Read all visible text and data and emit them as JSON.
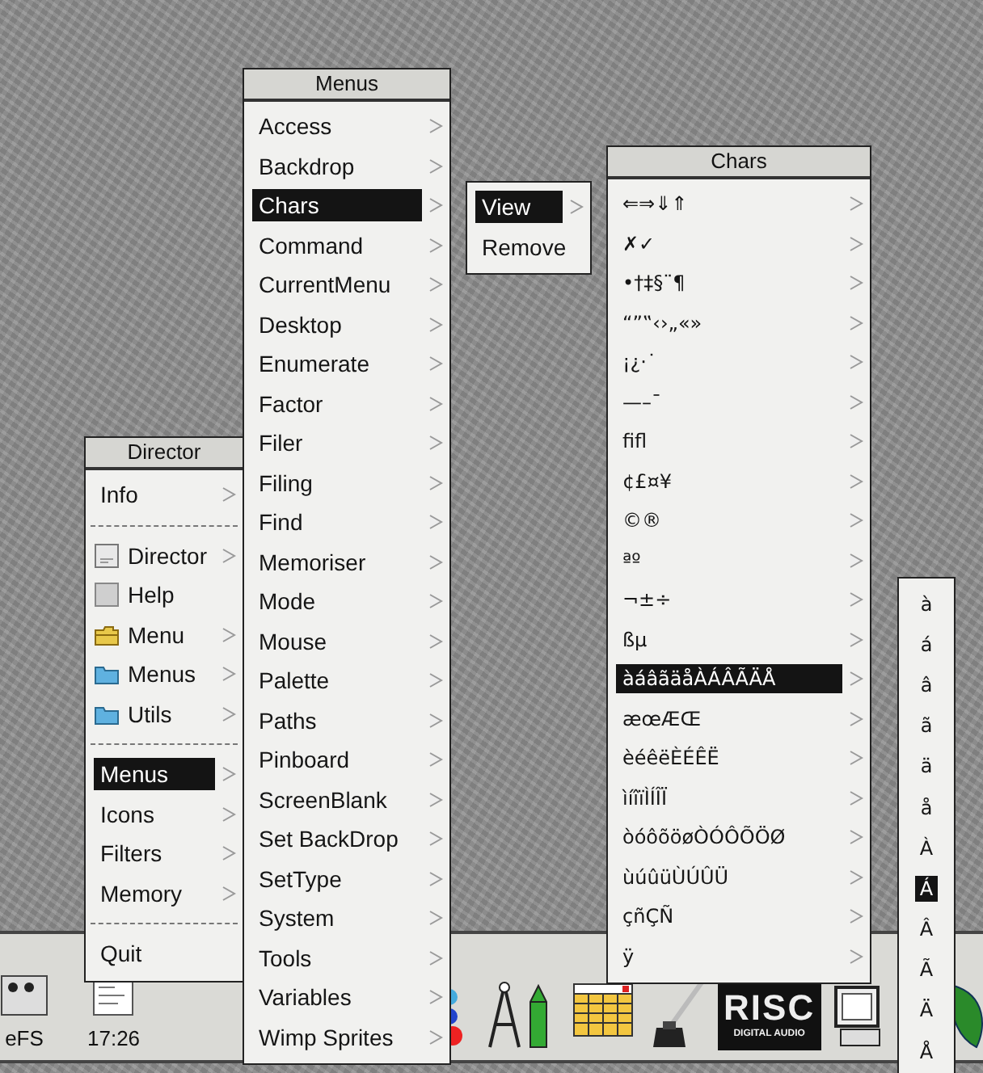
{
  "menus": [
    {
      "title": "Director",
      "items": [
        {
          "label": "Info",
          "submenu": true,
          "selected": false,
          "separator_after": true
        },
        {
          "label": "Director",
          "submenu": true,
          "selected": false,
          "kind": "app"
        },
        {
          "label": "Help",
          "submenu": false,
          "selected": false,
          "kind": "document"
        },
        {
          "label": "Menu",
          "submenu": true,
          "selected": false,
          "kind": "open-folder"
        },
        {
          "label": "Menus",
          "submenu": true,
          "selected": false,
          "kind": "folder"
        },
        {
          "label": "Utils",
          "submenu": true,
          "selected": false,
          "kind": "folder",
          "separator_after": true
        },
        {
          "label": "Menus",
          "submenu": true,
          "selected": true
        },
        {
          "label": "Icons",
          "submenu": true,
          "selected": false
        },
        {
          "label": "Filters",
          "submenu": true,
          "selected": false
        },
        {
          "label": "Memory",
          "submenu": true,
          "selected": false,
          "separator_after": true
        },
        {
          "label": "Quit",
          "submenu": false,
          "selected": false
        }
      ]
    },
    {
      "title": "Menus",
      "items": [
        {
          "label": "Access",
          "submenu": true,
          "selected": false
        },
        {
          "label": "Backdrop",
          "submenu": true,
          "selected": false
        },
        {
          "label": "Chars",
          "submenu": true,
          "selected": true
        },
        {
          "label": "Command",
          "submenu": true,
          "selected": false
        },
        {
          "label": "CurrentMenu",
          "submenu": true,
          "selected": false
        },
        {
          "label": "Desktop",
          "submenu": true,
          "selected": false
        },
        {
          "label": "Enumerate",
          "submenu": true,
          "selected": false
        },
        {
          "label": "Factor",
          "submenu": true,
          "selected": false
        },
        {
          "label": "Filer",
          "submenu": true,
          "selected": false
        },
        {
          "label": "Filing",
          "submenu": true,
          "selected": false
        },
        {
          "label": "Find",
          "submenu": true,
          "selected": false
        },
        {
          "label": "Memoriser",
          "submenu": true,
          "selected": false
        },
        {
          "label": "Mode",
          "submenu": true,
          "selected": false
        },
        {
          "label": "Mouse",
          "submenu": true,
          "selected": false
        },
        {
          "label": "Palette",
          "submenu": true,
          "selected": false
        },
        {
          "label": "Paths",
          "submenu": true,
          "selected": false
        },
        {
          "label": "Pinboard",
          "submenu": true,
          "selected": false
        },
        {
          "label": "ScreenBlank",
          "submenu": true,
          "selected": false
        },
        {
          "label": "Set BackDrop",
          "submenu": true,
          "selected": false
        },
        {
          "label": "SetType",
          "submenu": true,
          "selected": false
        },
        {
          "label": "System",
          "submenu": true,
          "selected": false
        },
        {
          "label": "Tools",
          "submenu": true,
          "selected": false
        },
        {
          "label": "Variables",
          "submenu": true,
          "selected": false
        },
        {
          "label": "Wimp Sprites",
          "submenu": true,
          "selected": false
        }
      ]
    },
    {
      "items": [
        {
          "label": "View",
          "submenu": true,
          "selected": true
        },
        {
          "label": "Remove",
          "submenu": false,
          "selected": false
        }
      ]
    },
    {
      "title": "Chars",
      "items": [
        {
          "label": "⇐⇒⇓⇑",
          "submenu": true,
          "selected": false
        },
        {
          "label": "✗✓",
          "submenu": true,
          "selected": false
        },
        {
          "label": "•†‡§¨¶",
          "submenu": true,
          "selected": false
        },
        {
          "label": "“”‟‹›„«»",
          "submenu": true,
          "selected": false
        },
        {
          "label": "¡¿·˙",
          "submenu": true,
          "selected": false
        },
        {
          "label": "—–¯",
          "submenu": true,
          "selected": false
        },
        {
          "label": "ﬁﬂ",
          "submenu": true,
          "selected": false
        },
        {
          "label": "¢£¤¥",
          "submenu": true,
          "selected": false
        },
        {
          "label": "©®",
          "submenu": true,
          "selected": false
        },
        {
          "label": "ªº",
          "submenu": true,
          "selected": false
        },
        {
          "label": "¬±÷",
          "submenu": true,
          "selected": false
        },
        {
          "label": "ßµ",
          "submenu": true,
          "selected": false
        },
        {
          "label": "àáâãäåÀÁÂÃÄÅ",
          "submenu": true,
          "selected": true
        },
        {
          "label": "æœÆŒ",
          "submenu": true,
          "selected": false
        },
        {
          "label": "èéêëÈÉÊË",
          "submenu": true,
          "selected": false
        },
        {
          "label": "ìíîïÌÍÎÏ",
          "submenu": true,
          "selected": false
        },
        {
          "label": "òóôõöøÒÓÔÕÖØ",
          "submenu": true,
          "selected": false
        },
        {
          "label": "ùúûüÙÚÛÜ",
          "submenu": true,
          "selected": false
        },
        {
          "label": "çñÇÑ",
          "submenu": true,
          "selected": false
        },
        {
          "label": "ÿ",
          "submenu": true,
          "selected": false
        }
      ]
    },
    {
      "items": [
        {
          "label": "à",
          "submenu": false,
          "selected": false
        },
        {
          "label": "á",
          "submenu": false,
          "selected": false
        },
        {
          "label": "â",
          "submenu": false,
          "selected": false
        },
        {
          "label": "ã",
          "submenu": false,
          "selected": false
        },
        {
          "label": "ä",
          "submenu": false,
          "selected": false
        },
        {
          "label": "å",
          "submenu": false,
          "selected": false
        },
        {
          "label": "À",
          "submenu": false,
          "selected": false
        },
        {
          "label": "Á",
          "submenu": false,
          "selected": true
        },
        {
          "label": "Â",
          "submenu": false,
          "selected": false
        },
        {
          "label": "Ã",
          "submenu": false,
          "selected": false
        },
        {
          "label": "Ä",
          "submenu": false,
          "selected": false
        },
        {
          "label": "Å",
          "submenu": false,
          "selected": false
        }
      ]
    }
  ],
  "icon_bar": {
    "items": [
      {
        "kind": "drive",
        "label": "eFS"
      },
      {
        "kind": "clock",
        "label": "17:26"
      },
      {
        "kind": "palette"
      },
      {
        "kind": "draw"
      },
      {
        "kind": "spreadsheet"
      },
      {
        "kind": "ink"
      },
      {
        "kind": "cd-logo",
        "lines": [
          "RISC",
          "DIGITAL AUDIO"
        ]
      },
      {
        "kind": "monitor"
      },
      {
        "kind": "leaf"
      }
    ]
  }
}
